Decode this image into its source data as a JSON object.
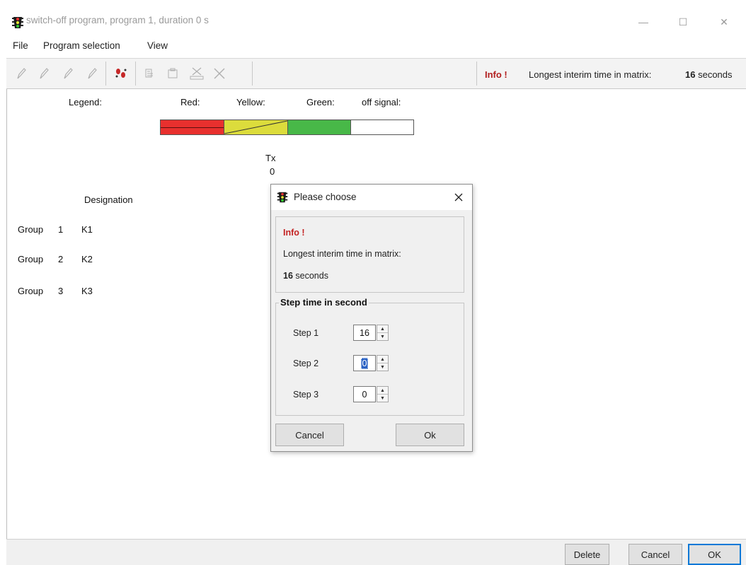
{
  "window": {
    "title": "switch-off program, program 1, duration 0 s",
    "icon": "traffic-light-icon",
    "controls": {
      "minimize": "—",
      "maximize": "☐",
      "close": "✕"
    }
  },
  "menu": [
    "File",
    "Program selection",
    "View"
  ],
  "toolbar": {
    "info_label": "Info !",
    "info_text": "Longest interim time in matrix:",
    "info_number": "16",
    "info_unit": "seconds"
  },
  "legend": {
    "title": "Legend:",
    "red": "Red:",
    "yellow": "Yellow:",
    "green": "Green:",
    "off": "off signal:",
    "colors": {
      "red": "#e8302e",
      "yellow": "#dcdc3c",
      "green": "#48b848",
      "off": "#ffffff"
    }
  },
  "timeline": {
    "marker": "Tx",
    "value": "0"
  },
  "table": {
    "designation_header": "Designation",
    "groups": [
      {
        "group_label": "Group",
        "number": "1",
        "name": "K1"
      },
      {
        "group_label": "Group",
        "number": "2",
        "name": "K2"
      },
      {
        "group_label": "Group",
        "number": "3",
        "name": "K3"
      }
    ]
  },
  "bottom_buttons": {
    "delete": "Delete",
    "cancel": "Cancel",
    "ok": "OK"
  },
  "dialog": {
    "title": "Please choose",
    "info_heading": "Info !",
    "info_line": "Longest interim time in matrix:",
    "info_number": "16",
    "info_unit": "seconds",
    "step_group_title": "Step time in second",
    "steps": [
      {
        "label": "Step 1",
        "value": "16"
      },
      {
        "label": "Step 2",
        "value": "0"
      },
      {
        "label": "Step 3",
        "value": "0"
      }
    ],
    "cancel": "Cancel",
    "ok": "Ok"
  }
}
